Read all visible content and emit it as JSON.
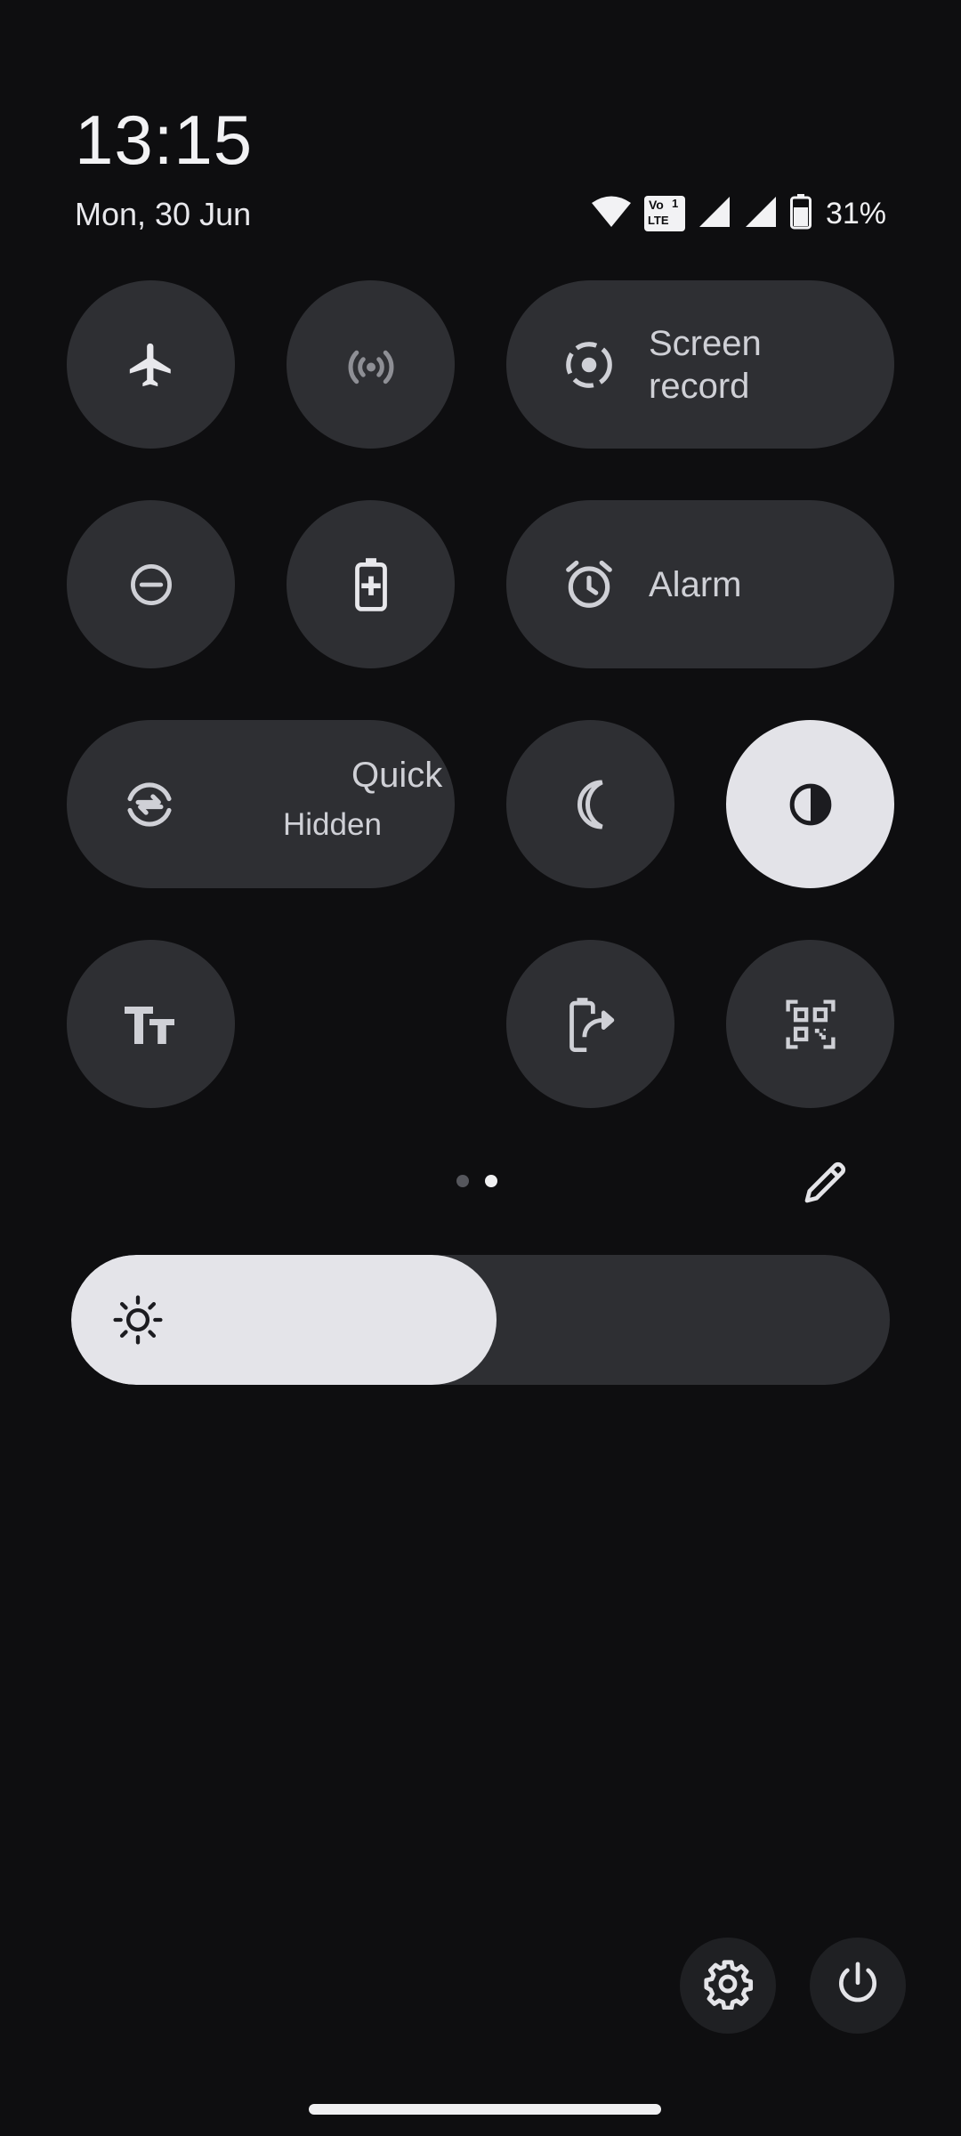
{
  "status_bar": {
    "time": "13:15",
    "date": "Mon, 30 Jun",
    "battery_percent": "31%",
    "volte_text_top": "Vo",
    "volte_text_bottom": "LTE",
    "sim_slot": "1",
    "icons": [
      "wifi-icon",
      "volte-icon",
      "signal-icon",
      "signal-icon",
      "battery-icon"
    ]
  },
  "quick_settings": {
    "page_1": [
      {
        "name": "airplane-mode",
        "icon": "airplane-icon",
        "active": false
      },
      {
        "name": "hotspot",
        "icon": "hotspot-icon",
        "active": false
      },
      {
        "name": "screen-record",
        "icon": "screen-record-icon",
        "label": "Screen record",
        "active": false
      },
      {
        "name": "do-not-disturb",
        "icon": "do-not-disturb-icon",
        "active": false
      },
      {
        "name": "battery-saver",
        "icon": "battery-saver-icon",
        "active": false
      },
      {
        "name": "alarm",
        "icon": "alarm-icon",
        "label": "Alarm",
        "active": false
      },
      {
        "name": "quick-share",
        "icon": "quick-share-icon",
        "label": "Quick S",
        "sublabel": "Hidden",
        "active": false
      },
      {
        "name": "night-light",
        "icon": "moon-icon",
        "active": false
      },
      {
        "name": "color-inversion",
        "icon": "contrast-icon",
        "active": true
      },
      {
        "name": "font-size",
        "icon": "font-size-icon",
        "active": false
      },
      {
        "name": "battery-share",
        "icon": "battery-share-icon",
        "active": false
      },
      {
        "name": "qr-scanner",
        "icon": "qr-scanner-icon",
        "active": false
      }
    ],
    "page_indicator": {
      "pages": 2,
      "current": 2
    },
    "edit_icon": "pencil-icon"
  },
  "brightness": {
    "level": 0.52,
    "icon": "sun-icon"
  },
  "footer": {
    "settings_icon": "gear-icon",
    "power_icon": "power-icon"
  },
  "colors": {
    "background": "#0e0e10",
    "tile": "#2e2f33",
    "tile_active": "#e3e3e8",
    "text": "#cfd0d6"
  }
}
